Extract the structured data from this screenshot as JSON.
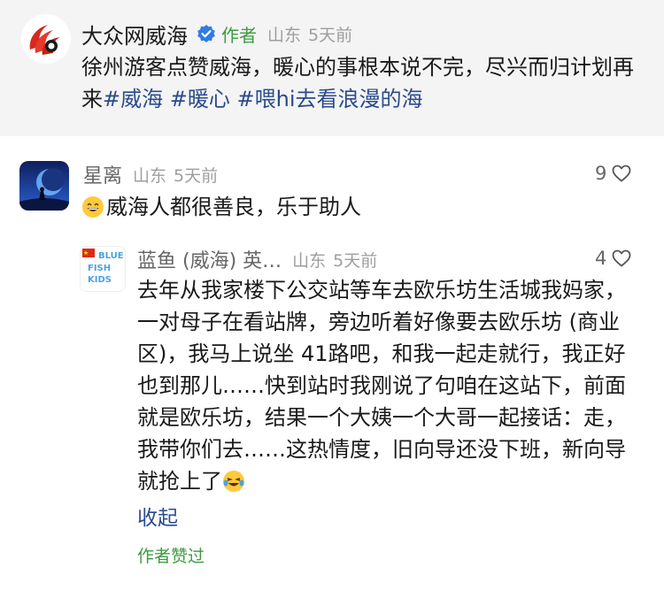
{
  "post": {
    "account_name": "大众网威海",
    "author_tag": "作者",
    "location": "山东",
    "time": "5天前",
    "text": "徐州游客点赞威海，暖心的事根本说不完，尽兴而归计划再来",
    "hashtags": [
      "#威海",
      "#暖心",
      "#喂hi去看浪漫的海"
    ],
    "icons": {
      "avatar": "dazhong-logo-icon",
      "verified": "verified-check-icon"
    }
  },
  "comments": [
    {
      "name": "星离",
      "location": "山东",
      "time": "5天前",
      "likes": "9",
      "text": "威海人都很善良，乐于助人",
      "icons": {
        "emoji": "grinning-face-emoji-icon",
        "like": "heart-outline-icon"
      }
    },
    {
      "name": "蓝鱼 (威海) 英…",
      "location": "山东",
      "time": "5天前",
      "likes": "4",
      "text": "去年从我家楼下公交站等车去欧乐坊生活城我妈家，一对母子在看站牌，旁边听着好像要去欧乐坊 (商业区)，我马上说坐 41路吧，和我一起走就行，我正好也到那儿……快到站时我刚说了句咱在这站下，前面就是欧乐坊，结果一个大姨一个大哥一起接话：走，我带你们去……这热情度，旧向导还没下班，新向导就抢上了",
      "avatar_text": [
        "BLUE",
        "FISH",
        "KIDS"
      ],
      "icons": {
        "emoji": "laughing-tears-emoji-icon",
        "like": "heart-outline-icon",
        "flag": "china-flag-icon"
      }
    }
  ],
  "collapse_label": "收起",
  "author_liked_label": "作者赞过",
  "colors": {
    "accent_green": "#3c9a3f",
    "link_blue": "#2a4b8d",
    "meta_gray": "#9e9e9e"
  }
}
